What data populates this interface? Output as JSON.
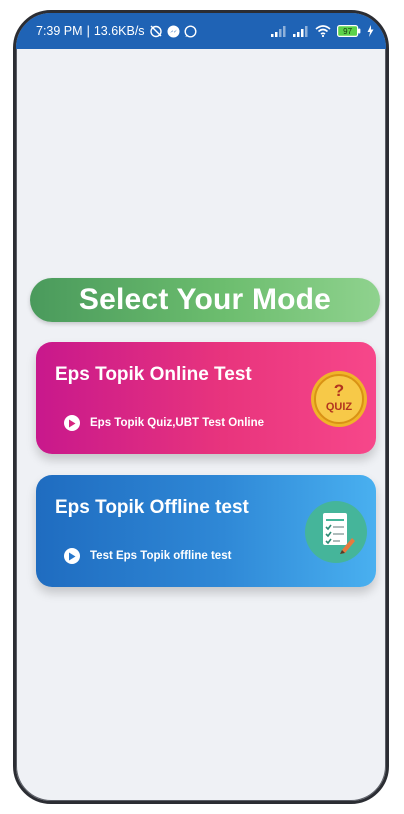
{
  "status_bar": {
    "time": "7:39 PM",
    "network_speed": "13.6KB/s",
    "battery": "97",
    "icons": [
      "alarm-off-icon",
      "messenger-icon",
      "whatsapp-icon",
      "signal-icon",
      "signal-icon",
      "wifi-icon",
      "battery-icon",
      "charging-icon"
    ]
  },
  "main": {
    "title": "Select Your Mode",
    "modes": [
      {
        "title": "Eps Topik Online Test",
        "subtitle": "Eps Topik Quiz,UBT Test Online",
        "icon": "quiz-badge-icon"
      },
      {
        "title": "Eps Topik Offline test",
        "subtitle": "Test Eps Topik offline test",
        "icon": "checklist-badge-icon"
      }
    ]
  },
  "colors": {
    "status_bar": "#1f63b5",
    "title_bar": "#6cbd6e",
    "online_card": "#e8347d",
    "offline_card": "#2f88d6",
    "screen_background": "#eff1f5"
  }
}
